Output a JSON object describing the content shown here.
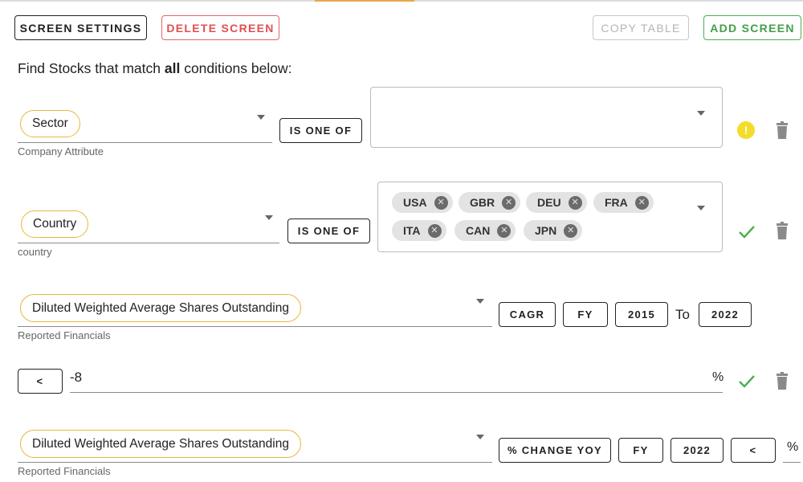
{
  "toolbar": {
    "screen_settings": "SCREEN SETTINGS",
    "delete_screen": "DELETE SCREEN",
    "copy_table": "COPY TABLE",
    "add_screen": "ADD SCREEN"
  },
  "headline": {
    "prefix": "Find Stocks that match ",
    "bold": "all",
    "suffix": " conditions below:"
  },
  "conditions": [
    {
      "field": "Sector",
      "category": "Company Attribute",
      "operator": "IS ONE OF",
      "values": [],
      "status": "warning"
    },
    {
      "field": "Country",
      "category": "country",
      "operator": "IS ONE OF",
      "values": [
        "USA",
        "GBR",
        "DEU",
        "FRA",
        "ITA",
        "CAN",
        "JPN"
      ],
      "status": "valid"
    },
    {
      "field": "Diluted Weighted Average Shares Outstanding",
      "category": "Reported Financials",
      "calc": "CAGR",
      "period": "FY",
      "from_year": "2015",
      "to_label": "To",
      "to_year": "2022",
      "comparator": "<",
      "value": "-8",
      "unit": "%",
      "status": "valid"
    },
    {
      "field": "Diluted Weighted Average Shares Outstanding",
      "category": "Reported Financials",
      "calc": "% CHANGE YOY",
      "period": "FY",
      "year": "2022",
      "comparator": "<",
      "value": "",
      "unit": "%"
    }
  ],
  "colors": {
    "warning": "#f5dc2a",
    "valid": "#4caf50",
    "pill_border": "#e5b83d",
    "delete": "#e05050"
  },
  "icons": {
    "warning": "warning-circle-icon",
    "valid": "check-icon",
    "delete": "trash-icon",
    "chip_remove": "close-circle-icon",
    "dropdown": "caret-down-icon"
  }
}
